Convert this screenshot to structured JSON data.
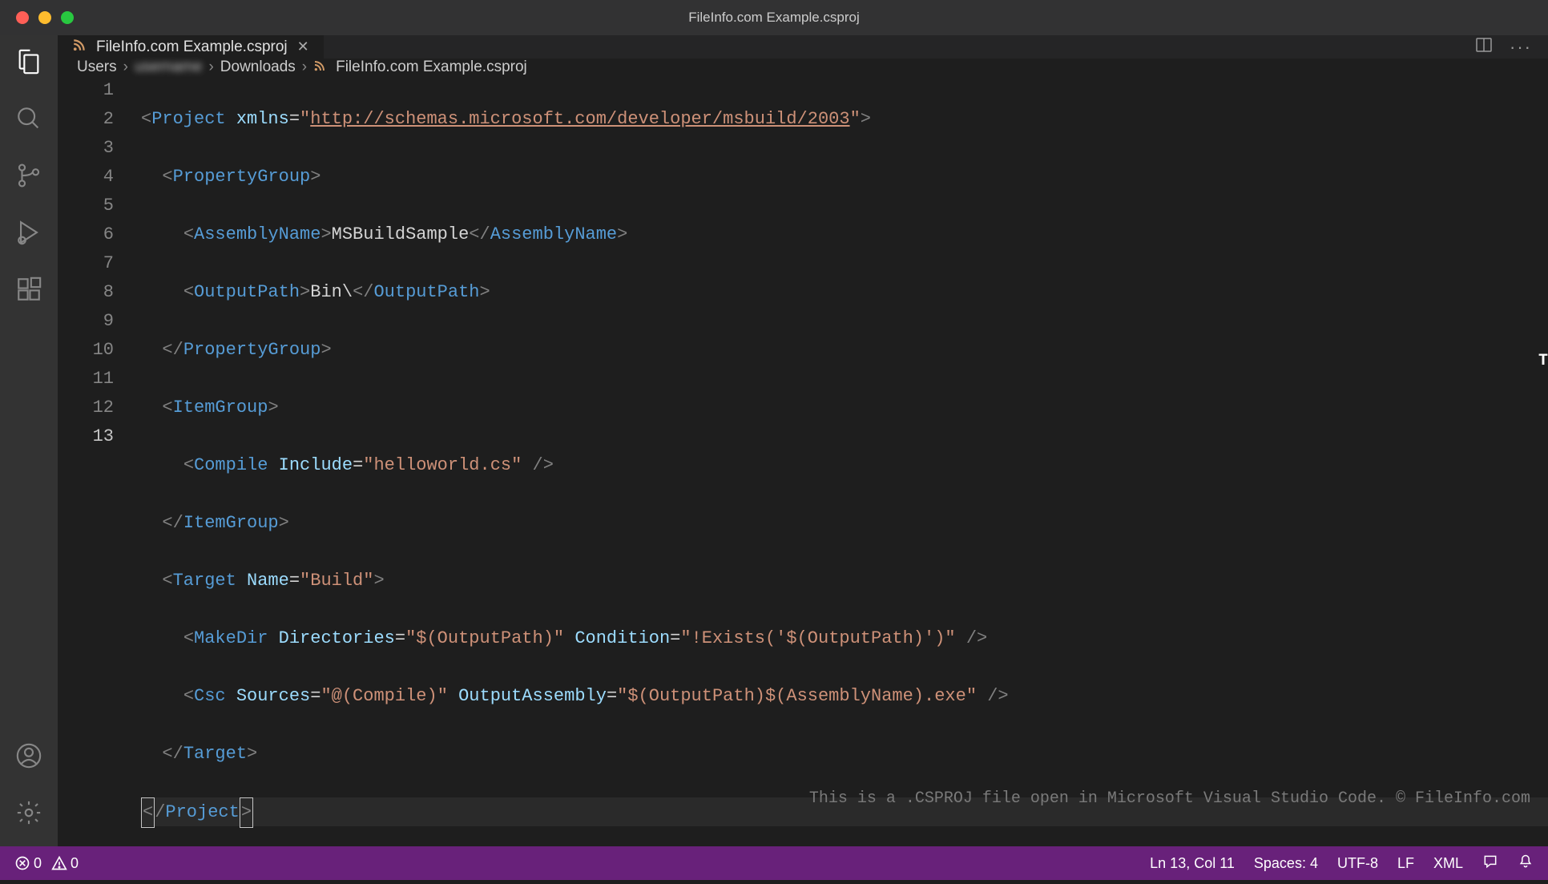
{
  "window": {
    "title": "FileInfo.com Example.csproj"
  },
  "tab": {
    "filename": "FileInfo.com Example.csproj"
  },
  "breadcrumbs": {
    "seg1": "Users",
    "seg2": "username",
    "seg3": "Downloads",
    "seg4": "FileInfo.com Example.csproj"
  },
  "gutter": {
    "l1": "1",
    "l2": "2",
    "l3": "3",
    "l4": "4",
    "l5": "5",
    "l6": "6",
    "l7": "7",
    "l8": "8",
    "l9": "9",
    "l10": "10",
    "l11": "11",
    "l12": "12",
    "l13": "13"
  },
  "code": {
    "xmlns_url": "http://schemas.microsoft.com/developer/msbuild/2003",
    "assembly_name": "MSBuildSample",
    "output_path": "Bin\\",
    "compile_include": "helloworld.cs",
    "target_name": "Build",
    "makedir_dirs": "$(OutputPath)",
    "makedir_cond": "!Exists('$(OutputPath)')",
    "csc_sources": "@(Compile)",
    "csc_output": "$(OutputPath)$(AssemblyName).exe",
    "tags": {
      "project": "Project",
      "propertygroup": "PropertyGroup",
      "assemblyname": "AssemblyName",
      "outputpath": "OutputPath",
      "itemgroup": "ItemGroup",
      "compile": "Compile",
      "target": "Target",
      "makedir": "MakeDir",
      "csc": "Csc"
    },
    "attrs": {
      "xmlns": "xmlns",
      "include": "Include",
      "name": "Name",
      "directories": "Directories",
      "condition": "Condition",
      "sources": "Sources",
      "outputassembly": "OutputAssembly"
    }
  },
  "caption": "This is a .CSPROJ file open in Microsoft Visual Studio Code. © FileInfo.com",
  "status": {
    "errors": "0",
    "warnings": "0",
    "cursor": "Ln 13, Col 11",
    "spaces": "Spaces: 4",
    "encoding": "UTF-8",
    "eol": "LF",
    "language": "XML"
  }
}
